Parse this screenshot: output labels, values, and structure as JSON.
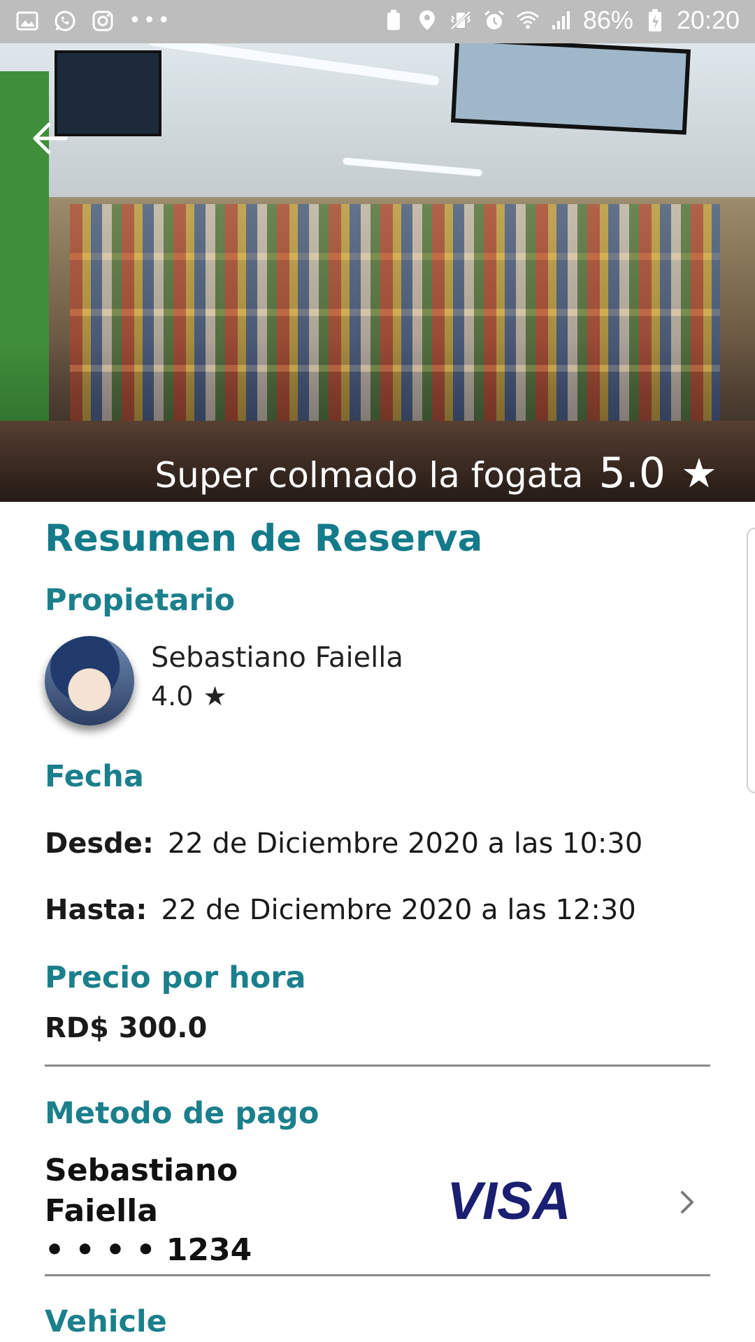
{
  "status_bar": {
    "left_icons": [
      "gallery-icon",
      "whatsapp-icon",
      "instagram-icon",
      "more-dots-icon"
    ],
    "battery_percent": "86%",
    "time": "20:20",
    "dots": "•••"
  },
  "hero": {
    "place_name": "Super colmado la fogata",
    "rating": "5.0",
    "star": "★"
  },
  "summary": {
    "title": "Resumen de Reserva",
    "owner_heading": "Propietario",
    "owner_name": "Sebastiano Faiella",
    "owner_rating": "4.0",
    "owner_star": "★",
    "date_heading": "Fecha",
    "from_label": "Desde:",
    "from_value": "22 de Diciembre 2020 a las 10:30",
    "to_label": "Hasta:",
    "to_value": "22 de Diciembre 2020 a las 12:30",
    "price_heading": "Precio por hora",
    "price_value": "RD$ 300.0",
    "payment_heading": "Metodo de pago",
    "card_holder": "Sebastiano Faiella",
    "card_number": "• • • •  1234",
    "card_brand": "VISA",
    "vehicle_heading": "Vehicle"
  },
  "colors": {
    "accent": "#137b8a",
    "status_bar": "#bdbdbd",
    "visa_blue": "#1a1f71"
  }
}
